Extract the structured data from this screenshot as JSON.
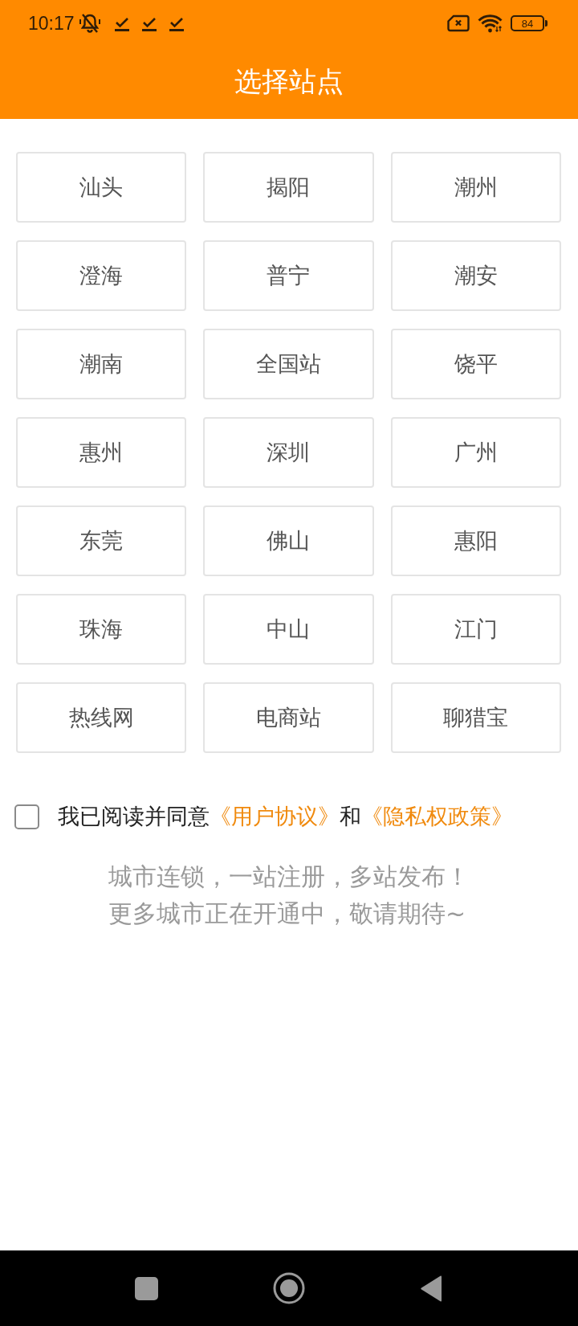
{
  "status_bar": {
    "time": "10:17",
    "battery": "84"
  },
  "header": {
    "title": "选择站点"
  },
  "stations": [
    {
      "label": "汕头"
    },
    {
      "label": "揭阳"
    },
    {
      "label": "潮州"
    },
    {
      "label": "澄海"
    },
    {
      "label": "普宁"
    },
    {
      "label": "潮安"
    },
    {
      "label": "潮南"
    },
    {
      "label": "全国站"
    },
    {
      "label": "饶平"
    },
    {
      "label": "惠州"
    },
    {
      "label": "深圳"
    },
    {
      "label": "广州"
    },
    {
      "label": "东莞"
    },
    {
      "label": "佛山"
    },
    {
      "label": "惠阳"
    },
    {
      "label": "珠海"
    },
    {
      "label": "中山"
    },
    {
      "label": "江门"
    },
    {
      "label": "热线网"
    },
    {
      "label": "电商站"
    },
    {
      "label": "聊猎宝"
    }
  ],
  "agreement": {
    "checked": false,
    "parts": [
      {
        "kind": "text",
        "text": "我已阅读并同意"
      },
      {
        "kind": "link",
        "text": "《用户协议》"
      },
      {
        "kind": "text",
        "text": "和"
      },
      {
        "kind": "link",
        "text": "《隐私权政策》"
      }
    ]
  },
  "tagline": [
    "城市连锁，一站注册，多站发布！",
    "更多城市正在开通中，敬请期待~"
  ]
}
